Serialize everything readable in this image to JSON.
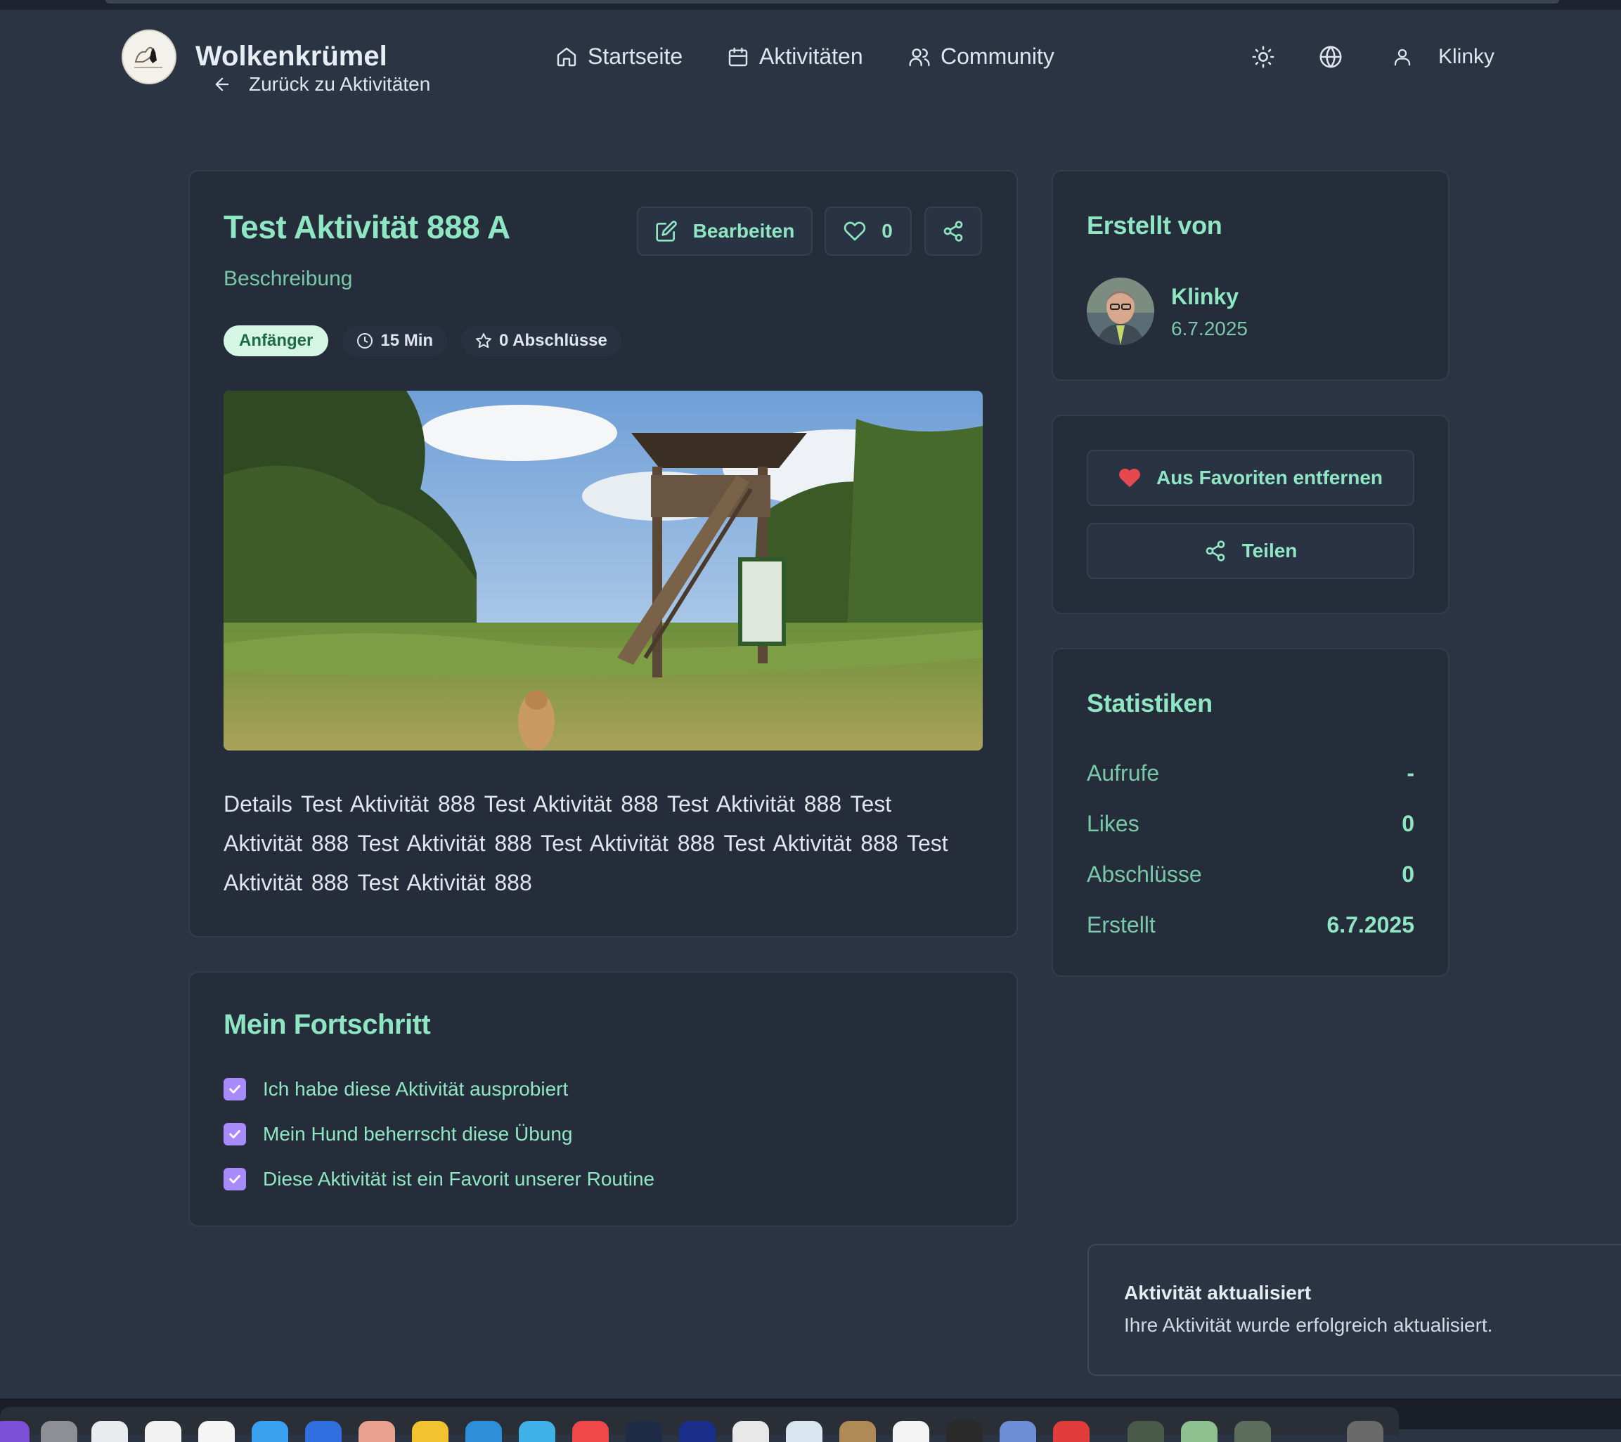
{
  "header": {
    "brand": "Wolkenkrümel",
    "back_label": "Zurück zu Aktivitäten",
    "nav": [
      {
        "label": "Startseite",
        "icon": "home-icon"
      },
      {
        "label": "Aktivitäten",
        "icon": "calendar-icon"
      },
      {
        "label": "Community",
        "icon": "users-icon"
      }
    ],
    "user_name": "Klinky"
  },
  "activity": {
    "title": "Test Aktivität 888 A",
    "subtitle": "Beschreibung",
    "edit_label": "Bearbeiten",
    "like_count": "0",
    "level": "Anfänger",
    "duration": "15 Min",
    "completions": "0 Abschlüsse",
    "details": "Details Test Aktivität  888 Test Aktivität  888 Test Aktivität  888 Test Aktivität  888 Test Aktivität  888 Test Aktivität  888 Test Aktivität  888 Test Aktivität  888 Test Aktivität  888"
  },
  "progress": {
    "title": "Mein Fortschritt",
    "items": [
      {
        "label": "Ich habe diese Aktivität ausprobiert",
        "checked": true
      },
      {
        "label": "Mein Hund beherrscht diese Übung",
        "checked": true
      },
      {
        "label": "Diese Aktivität ist ein Favorit unserer Routine",
        "checked": true
      }
    ]
  },
  "creator": {
    "heading": "Erstellt von",
    "name": "Klinky",
    "date": "6.7.2025"
  },
  "actions": {
    "unfavorite_label": "Aus Favoriten entfernen",
    "share_label": "Teilen"
  },
  "stats": {
    "heading": "Statistiken",
    "rows": [
      {
        "label": "Aufrufe",
        "value": "-"
      },
      {
        "label": "Likes",
        "value": "0"
      },
      {
        "label": "Abschlüsse",
        "value": "0"
      },
      {
        "label": "Erstellt",
        "value": "6.7.2025"
      }
    ]
  },
  "toast": {
    "title": "Aktivität aktualisiert",
    "message": "Ihre Aktivität wurde erfolgreich aktualisiert."
  },
  "colors": {
    "background": "#2b3443",
    "card": "#252d3a",
    "accent": "#8ee6c3",
    "checkbox": "#a78bfa",
    "heart": "#e5484d"
  }
}
